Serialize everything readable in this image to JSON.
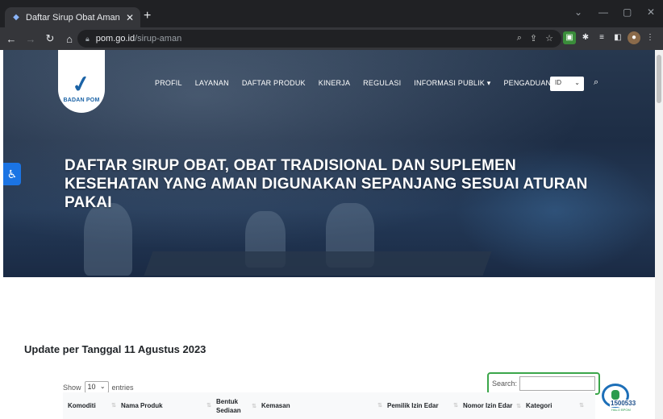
{
  "browser": {
    "tab_title": "Daftar Sirup Obat Aman | Badan",
    "tab_close": "✕",
    "new_tab": "+",
    "url_domain": "pom.go.id",
    "url_path": "/sirup-aman",
    "win_minimize": "—",
    "win_maximize": "▢",
    "win_close": "✕"
  },
  "site": {
    "logo_text": "BADAN POM",
    "nav": [
      "PROFIL",
      "LAYANAN",
      "DAFTAR PRODUK",
      "KINERJA",
      "REGULASI",
      "INFORMASI PUBLIK ▾",
      "PENGADUAN"
    ],
    "lang": "ID",
    "hero_title": "DAFTAR SIRUP OBAT, OBAT TRADISIONAL DAN SUPLEMEN KESEHATAN YANG AMAN DIGUNAKAN SEPANJANG SESUAI ATURAN PAKAI"
  },
  "content": {
    "update_title": "Update per Tanggal 11 Agustus 2023",
    "show_label": "Show",
    "entries_value": "10",
    "entries_label": "entries",
    "search_label": "Search:",
    "call_number": "1500533",
    "call_sub": "HALO BPOM",
    "columns": [
      "Komoditi",
      "Nama Produk",
      "Bentuk Sediaan",
      "Kemasan",
      "Pemilik Izin Edar",
      "Nomor Izin Edar",
      "Kategori"
    ]
  },
  "colors": {
    "accent_green": "#3ba64a",
    "brand_blue": "#1b63a6"
  }
}
